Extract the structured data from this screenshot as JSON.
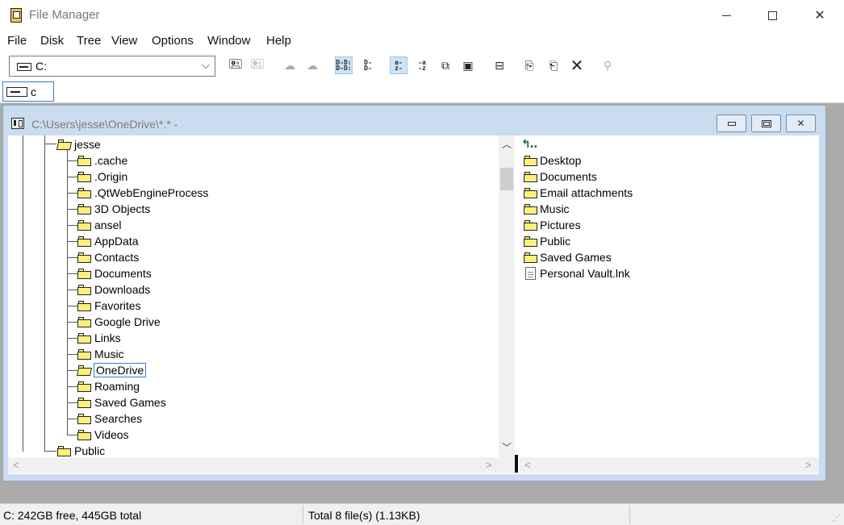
{
  "window": {
    "title": "File Manager"
  },
  "menu": [
    "File",
    "Disk",
    "Tree",
    "View",
    "Options",
    "Window",
    "Help"
  ],
  "toolbar": {
    "drive_select": "C:"
  },
  "drivebar": {
    "drive": "c"
  },
  "child": {
    "title": "C:\\Users\\jesse\\OneDrive\\*.* -"
  },
  "tree": {
    "parent": "jesse",
    "children": [
      ".cache",
      ".Origin",
      ".QtWebEngineProcess",
      "3D Objects",
      "ansel",
      "AppData",
      "Contacts",
      "Documents",
      "Downloads",
      "Favorites",
      "Google Drive",
      "Links",
      "Music",
      "OneDrive",
      "Roaming",
      "Saved Games",
      "Searches",
      "Videos"
    ],
    "selected": "OneDrive",
    "sibling": "Public"
  },
  "files": {
    "folders": [
      "Desktop",
      "Documents",
      "Email attachments",
      "Music",
      "Pictures",
      "Public",
      "Saved Games"
    ],
    "files": [
      "Personal Vault.lnk"
    ]
  },
  "status": {
    "disk": "C: 242GB free,  445GB total",
    "total": "Total 8 file(s) (1.13KB)"
  }
}
